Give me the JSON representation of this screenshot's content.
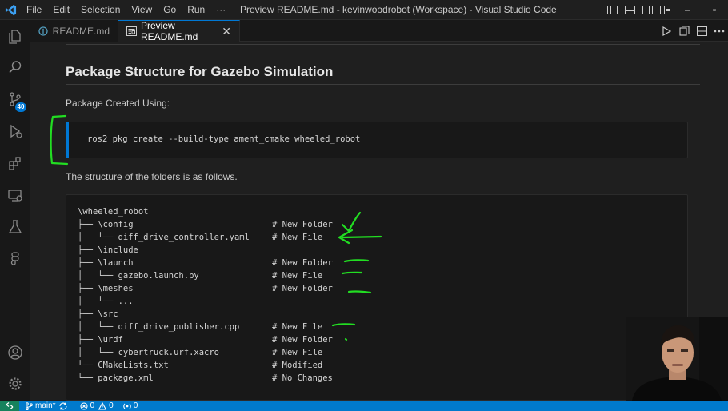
{
  "titlebar": {
    "menus": [
      "File",
      "Edit",
      "Selection",
      "View",
      "Go",
      "Run"
    ],
    "more": "···",
    "title": "Preview README.md - kevinwoodrobot (Workspace) - Visual Studio Code",
    "win_min": "–",
    "win_max": "▫"
  },
  "activitybar": {
    "items": [
      "explorer-icon",
      "search-icon",
      "source-control-icon",
      "run-debug-icon",
      "extensions-icon",
      "remote-explorer-icon",
      "testing-icon",
      "figma-icon"
    ],
    "scm_badge": "40",
    "bottom": [
      "accounts-icon",
      "manage-gear-icon"
    ]
  },
  "tabs": [
    {
      "label": "README.md",
      "active": false
    },
    {
      "label": "Preview README.md",
      "active": true,
      "close": "✕"
    }
  ],
  "preview": {
    "heading": "Package Structure for Gazebo Simulation",
    "package_created": "Package Created Using:",
    "command": "ros2 pkg create --build-type ament_cmake wheeled_robot",
    "structure_intro": "The structure of the folders is as follows.",
    "tree": [
      {
        "path": "\\wheeled_robot",
        "comment": ""
      },
      {
        "path": "├── \\config",
        "comment": "# New Folder"
      },
      {
        "path": "│   └── diff_drive_controller.yaml",
        "comment": "# New File"
      },
      {
        "path": "├── \\include",
        "comment": ""
      },
      {
        "path": "├── \\launch",
        "comment": "# New Folder"
      },
      {
        "path": "│   └── gazebo.launch.py",
        "comment": "# New File"
      },
      {
        "path": "├── \\meshes",
        "comment": "# New Folder"
      },
      {
        "path": "│   └── ...",
        "comment": ""
      },
      {
        "path": "├── \\src",
        "comment": ""
      },
      {
        "path": "│   └── diff_drive_publisher.cpp",
        "comment": "# New File"
      },
      {
        "path": "├── \\urdf",
        "comment": "# New Folder"
      },
      {
        "path": "│   └── cybertruck.urf.xacro",
        "comment": "# New File"
      },
      {
        "path": "└── CMakeLists.txt",
        "comment": "# Modified"
      },
      {
        "path": "└── package.xml",
        "comment": "# No Changes"
      }
    ]
  },
  "statusbar": {
    "branch": "main*",
    "errors": "0",
    "warnings": "0",
    "ports": "0"
  },
  "colors": {
    "accent": "#0078d4",
    "status": "#007acc",
    "annotation": "#22dd22"
  }
}
